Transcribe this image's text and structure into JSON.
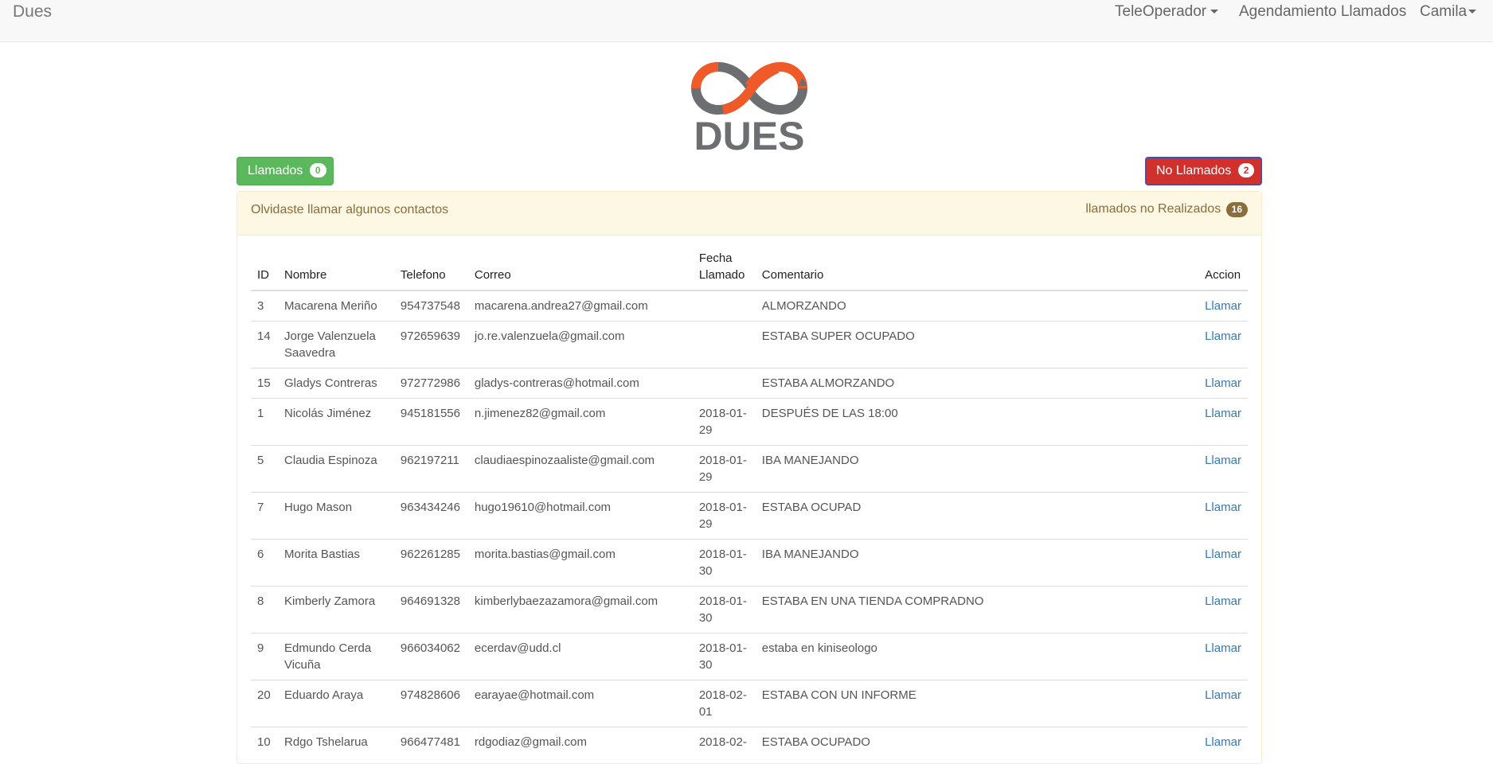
{
  "navbar": {
    "brand": "Dues",
    "menu_teleoperador": "TeleOperador",
    "menu_agendamiento": "Agendamiento Llamados",
    "menu_user": "Camila"
  },
  "logo": {
    "text": "DUES"
  },
  "buttons": {
    "llamados_label": "Llamados",
    "llamados_count": "0",
    "no_llamados_label": "No Llamados",
    "no_llamados_count": "2"
  },
  "panel": {
    "message": "Olvidaste llamar algunos contactos",
    "counter_label": "llamados no Realizados",
    "counter_value": "16"
  },
  "table": {
    "headers": {
      "id": "ID",
      "nombre": "Nombre",
      "telefono": "Telefono",
      "correo": "Correo",
      "fecha_line1": "Fecha",
      "fecha_line2": "Llamado",
      "comentario": "Comentario",
      "accion": "Accion"
    },
    "rows": [
      {
        "id": "3",
        "nombre": "Macarena Meriño",
        "telefono": "954737548",
        "correo": "macarena.andrea27@gmail.com",
        "fecha_a": "",
        "fecha_b": "",
        "comentario": "ALMORZANDO",
        "accion": "Llamar"
      },
      {
        "id": "14",
        "nombre": "Jorge Valenzuela Saavedra",
        "telefono": "972659639",
        "correo": "jo.re.valenzuela@gmail.com",
        "fecha_a": "",
        "fecha_b": "",
        "comentario": "ESTABA SUPER OCUPADO",
        "accion": "Llamar"
      },
      {
        "id": "15",
        "nombre": "Gladys Contreras",
        "telefono": "972772986",
        "correo": "gladys-contreras@hotmail.com",
        "fecha_a": "",
        "fecha_b": "",
        "comentario": "ESTABA ALMORZANDO",
        "accion": "Llamar"
      },
      {
        "id": "1",
        "nombre": "Nicolás Jiménez",
        "telefono": "945181556",
        "correo": "n.jimenez82@gmail.com",
        "fecha_a": "2018-01-",
        "fecha_b": "29",
        "comentario": "DESPUÉS DE LAS 18:00",
        "accion": "Llamar"
      },
      {
        "id": "5",
        "nombre": "Claudia Espinoza",
        "telefono": "962197211",
        "correo": "claudiaespinozaaliste@gmail.com",
        "fecha_a": "2018-01-",
        "fecha_b": "29",
        "comentario": "IBA MANEJANDO",
        "accion": "Llamar"
      },
      {
        "id": "7",
        "nombre": "Hugo Mason",
        "telefono": "963434246",
        "correo": "hugo19610@hotmail.com",
        "fecha_a": "2018-01-",
        "fecha_b": "29",
        "comentario": "ESTABA OCUPAD",
        "accion": "Llamar"
      },
      {
        "id": "6",
        "nombre": "Morita Bastias",
        "telefono": "962261285",
        "correo": "morita.bastias@gmail.com",
        "fecha_a": "2018-01-",
        "fecha_b": "30",
        "comentario": "IBA MANEJANDO",
        "accion": "Llamar"
      },
      {
        "id": "8",
        "nombre": "Kimberly Zamora",
        "telefono": "964691328",
        "correo": "kimberlybaezazamora@gmail.com",
        "fecha_a": "2018-01-",
        "fecha_b": "30",
        "comentario": "ESTABA EN UNA TIENDA COMPRADNO",
        "accion": "Llamar"
      },
      {
        "id": "9",
        "nombre": "Edmundo Cerda Vicuña",
        "telefono": "966034062",
        "correo": "ecerdav@udd.cl",
        "fecha_a": "2018-01-",
        "fecha_b": "30",
        "comentario": "estaba en kiniseologo",
        "accion": "Llamar"
      },
      {
        "id": "20",
        "nombre": "Eduardo Araya",
        "telefono": "974828606",
        "correo": "earayae@hotmail.com",
        "fecha_a": "2018-02-",
        "fecha_b": "01",
        "comentario": "ESTABA CON UN INFORME",
        "accion": "Llamar"
      },
      {
        "id": "10",
        "nombre": "Rdgo Tshelarua",
        "telefono": "966477481",
        "correo": "rdgodiaz@gmail.com",
        "fecha_a": "2018-02-",
        "fecha_b": "",
        "comentario": "ESTABA OCUPADO",
        "accion": "Llamar"
      }
    ]
  },
  "colors": {
    "success": "#5cb85c",
    "danger": "#d0312d",
    "warning_bg": "#fcf8e3",
    "warning_text": "#8a6d3b",
    "link": "#337ab7",
    "logo_orange": "#f05a28",
    "logo_gray": "#6d6e71"
  }
}
